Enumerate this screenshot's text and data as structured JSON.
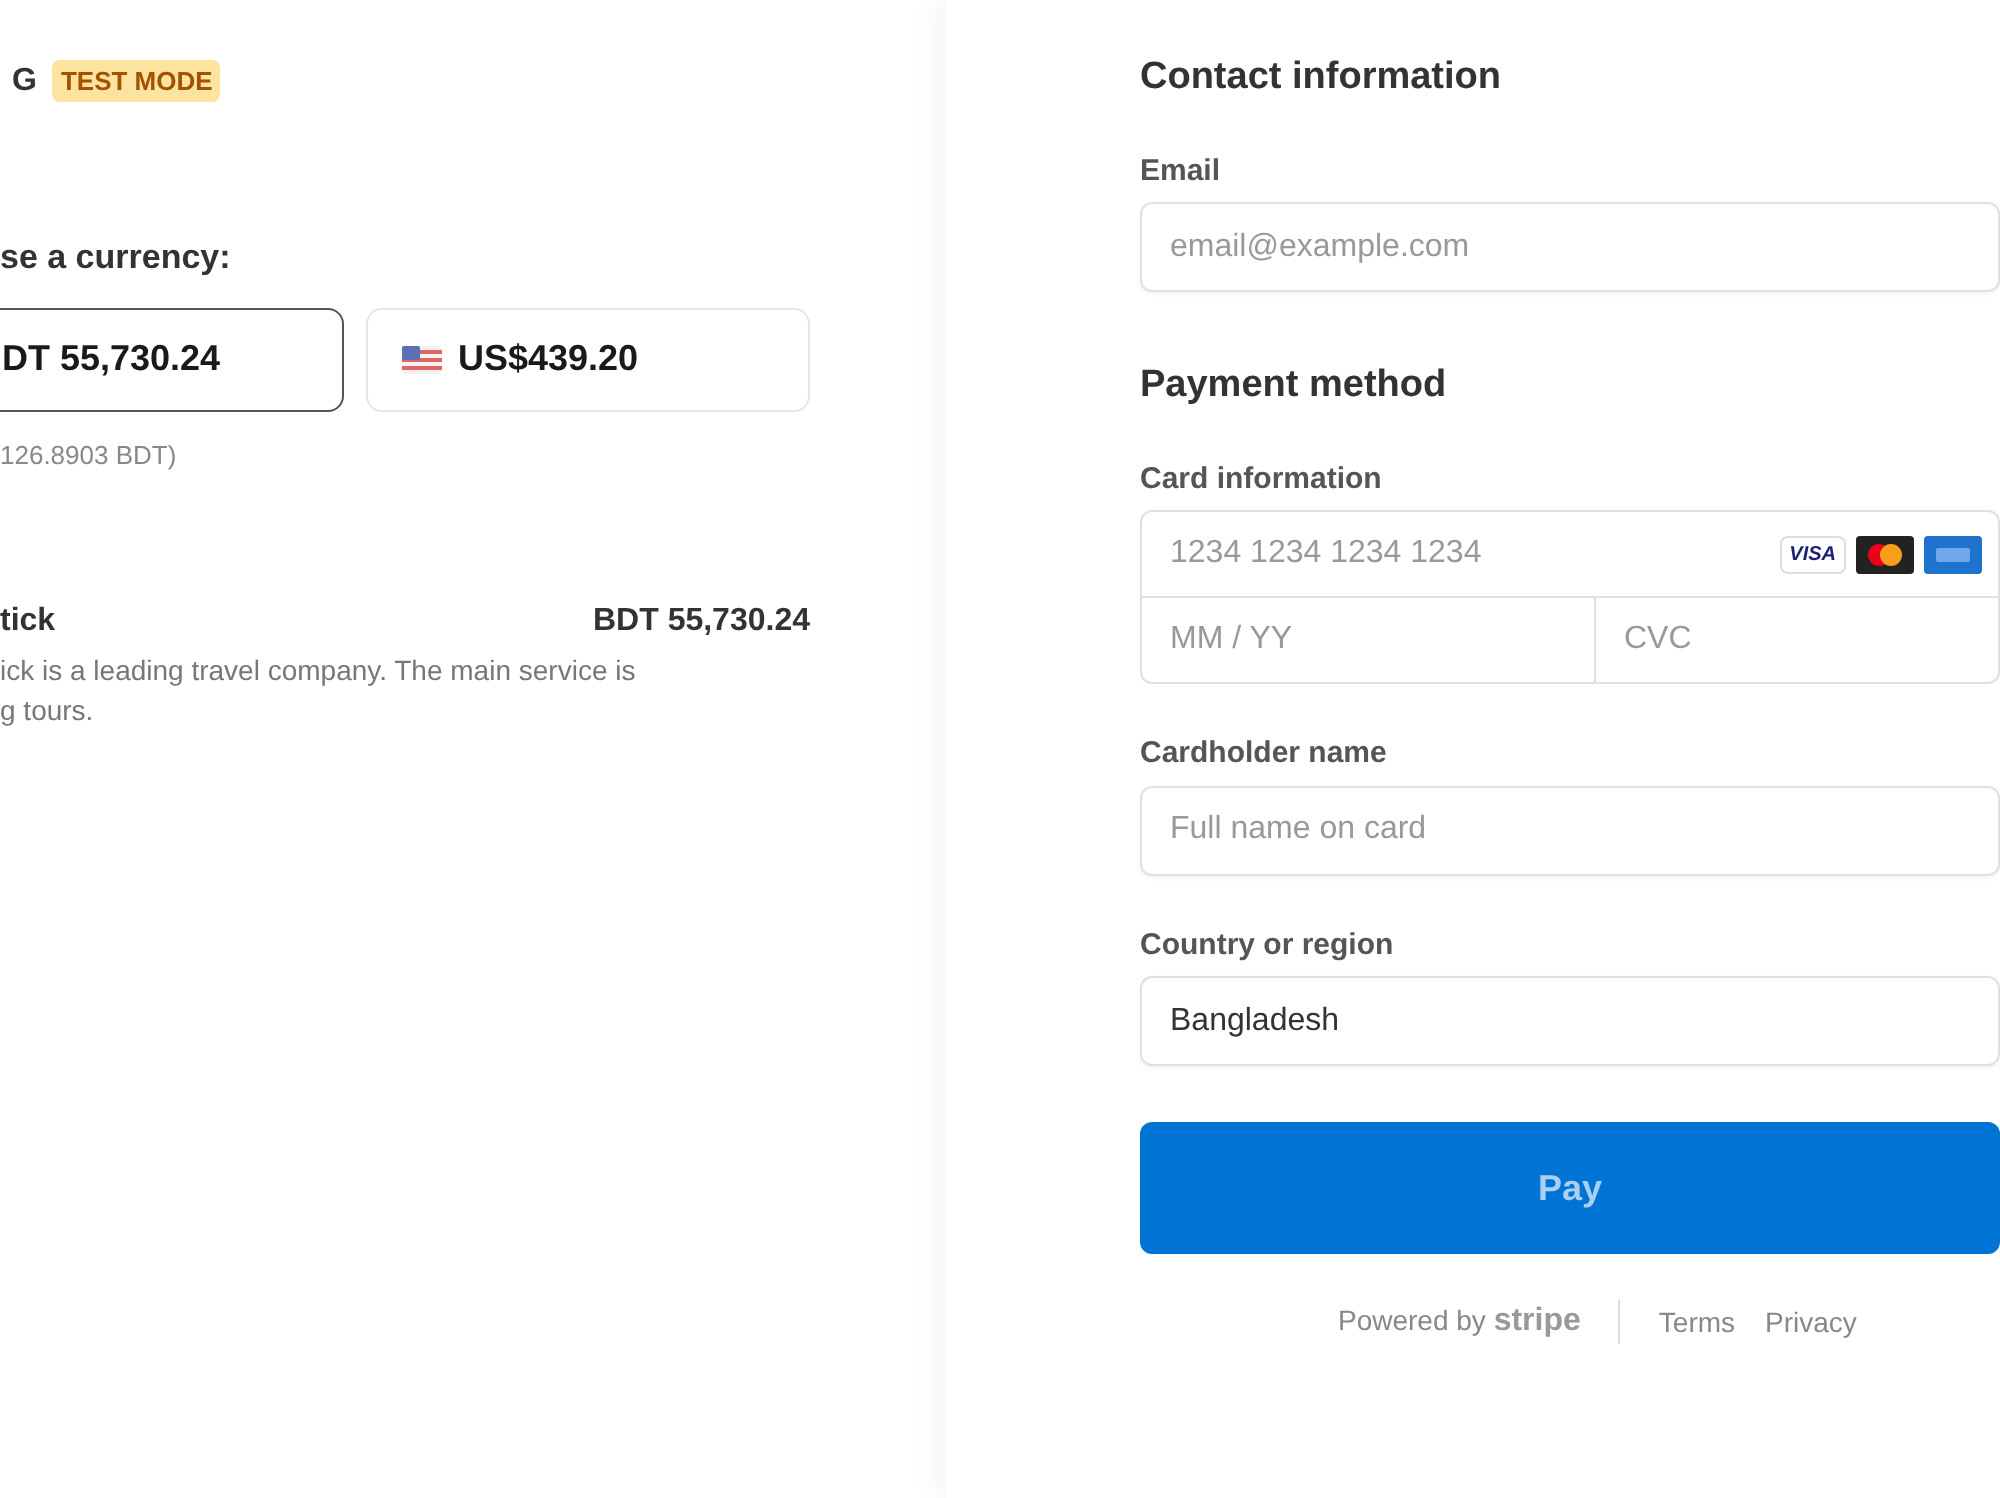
{
  "header": {
    "brand": "G",
    "badge": "TEST MODE"
  },
  "currency": {
    "heading": "se a currency:",
    "options": [
      {
        "label": "DT 55,730.24",
        "has_flag": false,
        "selected": true
      },
      {
        "label": "US$439.20",
        "has_flag": true,
        "selected": false
      }
    ],
    "rate": "126.8903 BDT)"
  },
  "line_item": {
    "name": "tick",
    "price": "BDT 55,730.24",
    "description": "ick is a leading travel company. The main service is",
    "description_2": "g tours."
  },
  "contact": {
    "heading": "Contact information",
    "email_label": "Email",
    "email_placeholder": "email@example.com"
  },
  "payment": {
    "heading": "Payment method",
    "card_label": "Card information",
    "card_number_placeholder": "1234 1234 1234 1234",
    "expiry_placeholder": "MM / YY",
    "cvc_placeholder": "CVC",
    "card_brand": "VISA",
    "name_label": "Cardholder name",
    "name_placeholder": "Full name on card",
    "country_label": "Country or region",
    "country": "Bangladesh"
  },
  "pay_button": "Pay",
  "footer": {
    "powered": "Powered by",
    "brand": "stripe",
    "links": [
      "Terms",
      "Privacy"
    ]
  }
}
